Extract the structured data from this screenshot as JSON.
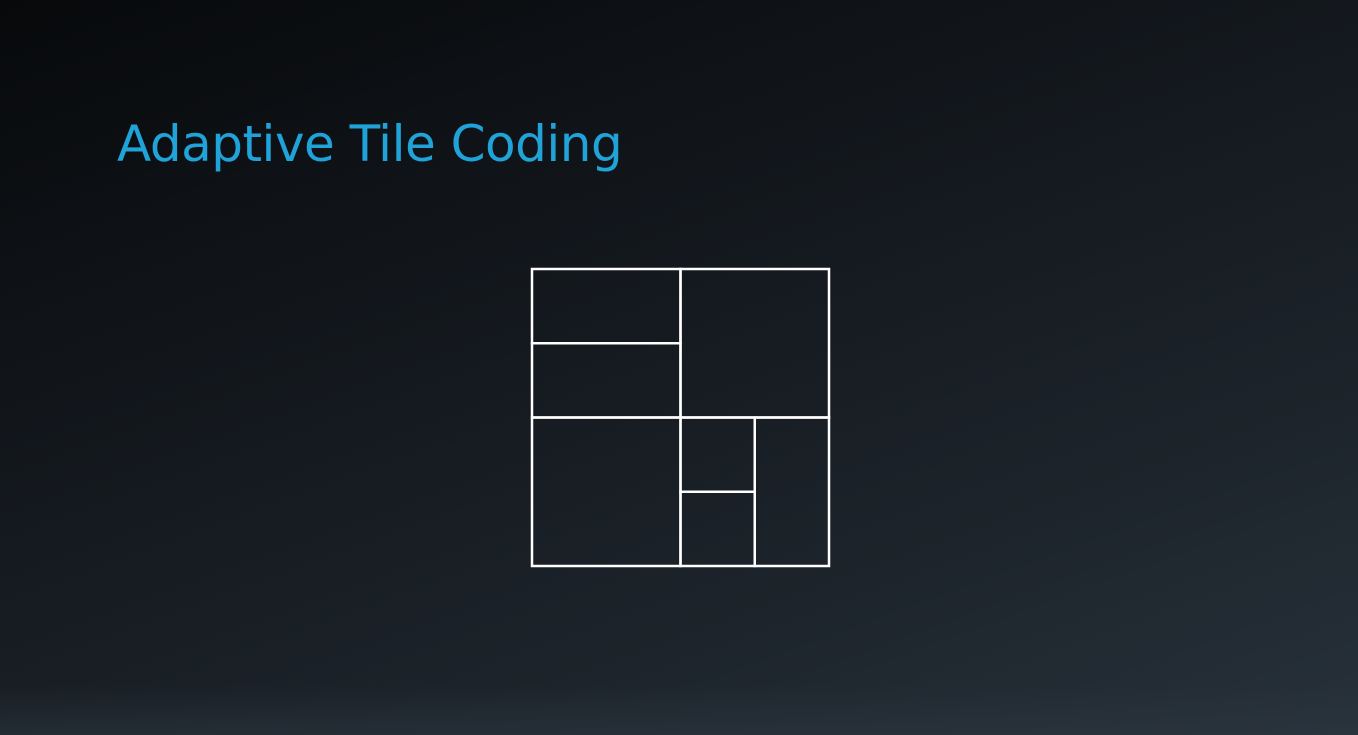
{
  "slide": {
    "title": "Adaptive Tile Coding",
    "title_color": "#1fa3d9",
    "background_color": "#151a1f"
  },
  "diagram": {
    "description_type": "adaptive tile partition of a square state space",
    "line_color": "#ffffff",
    "tiles": [
      {
        "name": "top-left-upper-tile"
      },
      {
        "name": "top-left-lower-tile"
      },
      {
        "name": "top-right-tile"
      },
      {
        "name": "bottom-left-tile"
      },
      {
        "name": "bottom-middle-upper-tile"
      },
      {
        "name": "bottom-middle-lower-tile"
      },
      {
        "name": "bottom-right-tile"
      }
    ]
  }
}
